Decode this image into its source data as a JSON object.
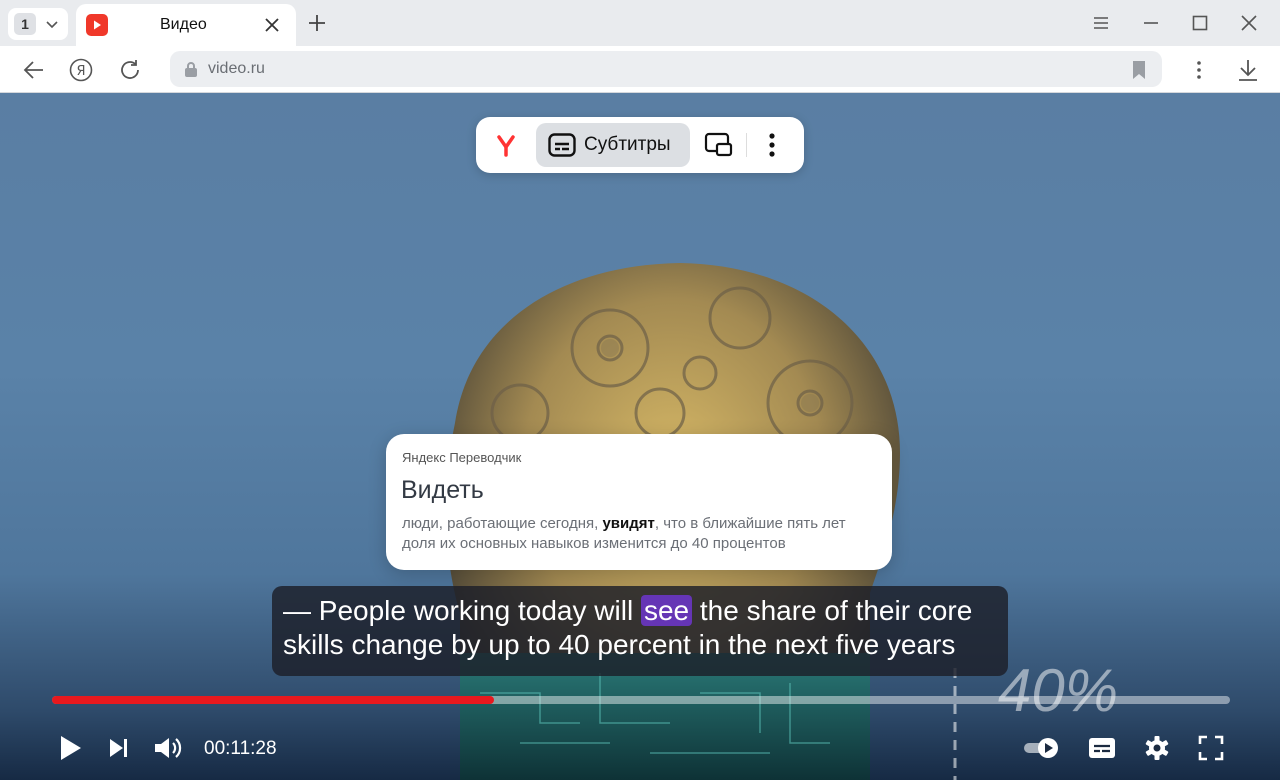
{
  "browser": {
    "tab_count": "1",
    "tab_title": "Видео",
    "url": "video.ru"
  },
  "overlay": {
    "subtitles_label": "Субтитры"
  },
  "translator": {
    "brand": "Яндекс Переводчик",
    "word": "Видеть",
    "context_before": "люди, работающие сегодня, ",
    "context_word": "увидят",
    "context_after": ", что в ближайшие пять лет доля их основных навыков изменится до 40 процентов"
  },
  "subtitle": {
    "line1_before": "— People working today will ",
    "line1_word": "see",
    "line1_after": " the share of their core",
    "line2": "skills change by up to 40 percent in the next five years"
  },
  "video_art": {
    "percent_text": "40%"
  },
  "player": {
    "time": "00:11:28",
    "progress": 0.375
  },
  "colors": {
    "accent_red": "#e8191e",
    "highlight_purple": "#6535b5",
    "favicon_red": "#f0382a"
  },
  "icons": [
    "chevron-down-icon",
    "play-favicon-icon",
    "close-icon",
    "plus-icon",
    "menu-icon",
    "minimize-icon",
    "maximize-icon",
    "back-icon",
    "yandex-icon",
    "reload-icon",
    "lock-icon",
    "bookmark-icon",
    "more-vertical-icon",
    "download-icon",
    "yandex-logo-icon",
    "subtitles-icon",
    "pip-icon",
    "play-icon",
    "next-icon",
    "volume-icon",
    "autoplay-toggle-icon",
    "captions-icon",
    "settings-icon",
    "fullscreen-icon"
  ]
}
